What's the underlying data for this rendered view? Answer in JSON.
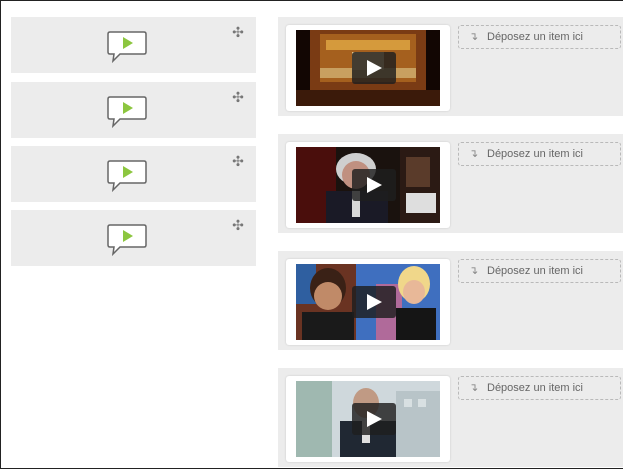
{
  "drag_items": [
    {
      "icon": "speech-bubble-play-icon",
      "handle_icon": "move-arrows-icon"
    },
    {
      "icon": "speech-bubble-play-icon",
      "handle_icon": "move-arrows-icon"
    },
    {
      "icon": "speech-bubble-play-icon",
      "handle_icon": "move-arrows-icon"
    },
    {
      "icon": "speech-bubble-play-icon",
      "handle_icon": "move-arrows-icon"
    }
  ],
  "drop_zones": [
    {
      "drop_label": "Déposez un item ici",
      "video_icon": "play-icon"
    },
    {
      "drop_label": "Déposez un item ici",
      "video_icon": "play-icon"
    },
    {
      "drop_label": "Déposez un item ici",
      "video_icon": "play-icon"
    },
    {
      "drop_label": "Déposez un item ici",
      "video_icon": "play-icon"
    }
  ],
  "colors": {
    "panel_bg": "#ececec",
    "accent_green": "#8cc63f",
    "bubble_stroke": "#666666"
  }
}
